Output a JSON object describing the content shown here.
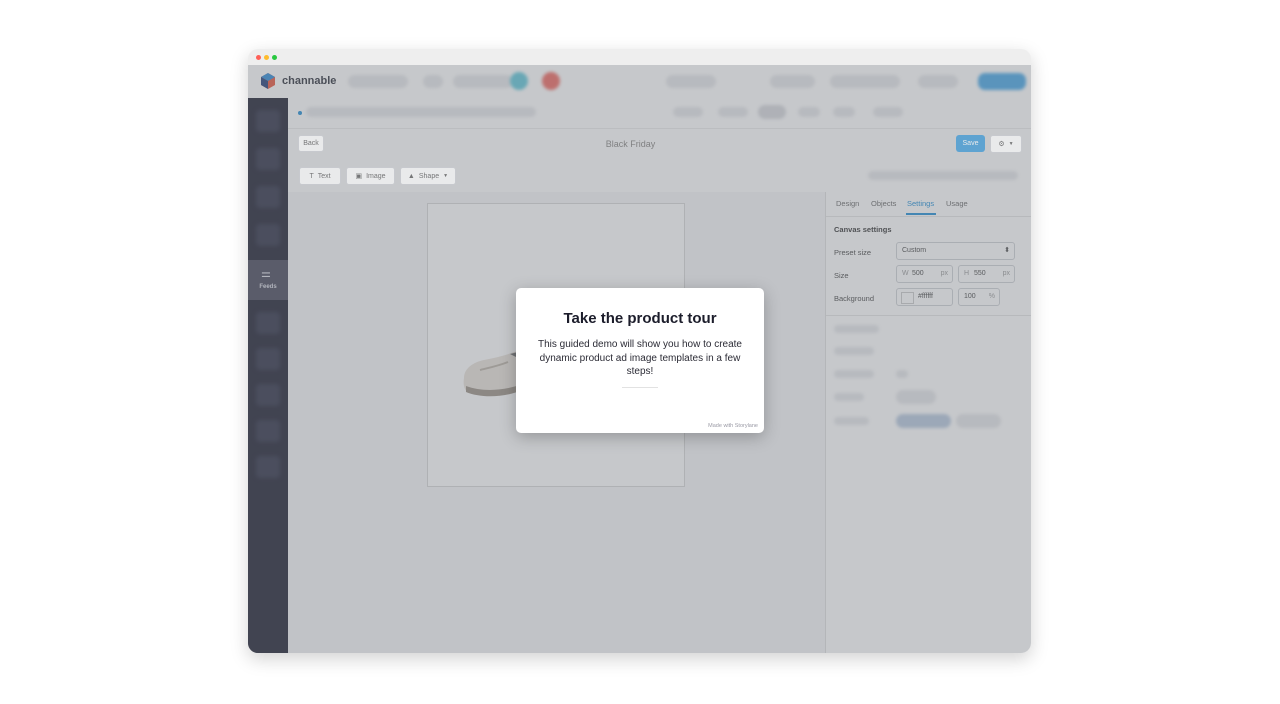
{
  "app": {
    "logo_text": "channable",
    "accent_color": "#1f8ed6"
  },
  "sidebar": {
    "active_item_label": "Feeds",
    "active_item_icon": "sliders-icon"
  },
  "editor": {
    "back_label": "Back",
    "title": "Black Friday",
    "save_label": "Save",
    "settings_menu_icon": "gear-icon",
    "tools": {
      "text_label": "Text",
      "image_label": "Image",
      "shape_label": "Shape"
    }
  },
  "panel": {
    "tabs": [
      {
        "label": "Design"
      },
      {
        "label": "Objects"
      },
      {
        "label": "Settings"
      },
      {
        "label": "Usage"
      }
    ],
    "active_tab": "Settings",
    "canvas_settings_title": "Canvas settings",
    "preset_size_label": "Preset size",
    "preset_size_value": "Custom",
    "size_label": "Size",
    "width_prefix": "W",
    "width_value": "500",
    "height_prefix": "H",
    "height_value": "550",
    "unit_px": "px",
    "background_label": "Background",
    "background_color": "#ffffff",
    "opacity_value": "100",
    "unit_percent": "%"
  },
  "modal": {
    "title": "Take the product tour",
    "body": "This guided demo will show you how to create dynamic product ad image templates in a few steps!",
    "credit": "Made with Storylane"
  }
}
